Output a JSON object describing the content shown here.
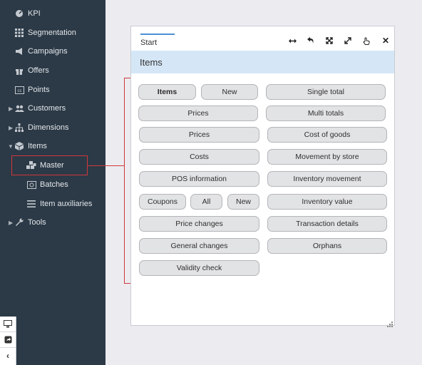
{
  "sidebar": {
    "items": [
      {
        "label": "KPI",
        "icon": "gauge-icon"
      },
      {
        "label": "Segmentation",
        "icon": "grid-icon"
      },
      {
        "label": "Campaigns",
        "icon": "megaphone-icon"
      },
      {
        "label": "Offers",
        "icon": "gift-icon"
      },
      {
        "label": "Points",
        "icon": "cc-icon"
      },
      {
        "label": "Customers",
        "icon": "users-icon"
      },
      {
        "label": "Dimensions",
        "icon": "sitemap-icon"
      },
      {
        "label": "Items",
        "icon": "box-icon"
      },
      {
        "label": "Master",
        "icon": "cubes-icon"
      },
      {
        "label": "Batches",
        "icon": "batch-icon"
      },
      {
        "label": "Item auxiliaries",
        "icon": "list-icon"
      },
      {
        "label": "Tools",
        "icon": "wrench-icon"
      }
    ]
  },
  "panel": {
    "tab": "Start",
    "header": "Items",
    "buttons": {
      "items": "Items",
      "new_top": "New",
      "single_total": "Single total",
      "prices_1": "Prices",
      "multi_totals": "Multi totals",
      "prices_2": "Prices",
      "cost_of_goods": "Cost of goods",
      "costs": "Costs",
      "movement_by_store": "Movement by store",
      "pos_information": "POS information",
      "inventory_movement": "Inventory movement",
      "coupons": "Coupons",
      "all": "All",
      "new_coupons": "New",
      "inventory_value": "Inventory value",
      "price_changes": "Price changes",
      "transaction_details": "Transaction details",
      "general_changes": "General changes",
      "orphans": "Orphans",
      "validity_check": "Validity check"
    }
  },
  "colors": {
    "sidebar_bg": "#2c3a47",
    "header_bg": "#d5e7f7",
    "highlight": "#d0373a",
    "tab_accent": "#4b8fd3"
  }
}
